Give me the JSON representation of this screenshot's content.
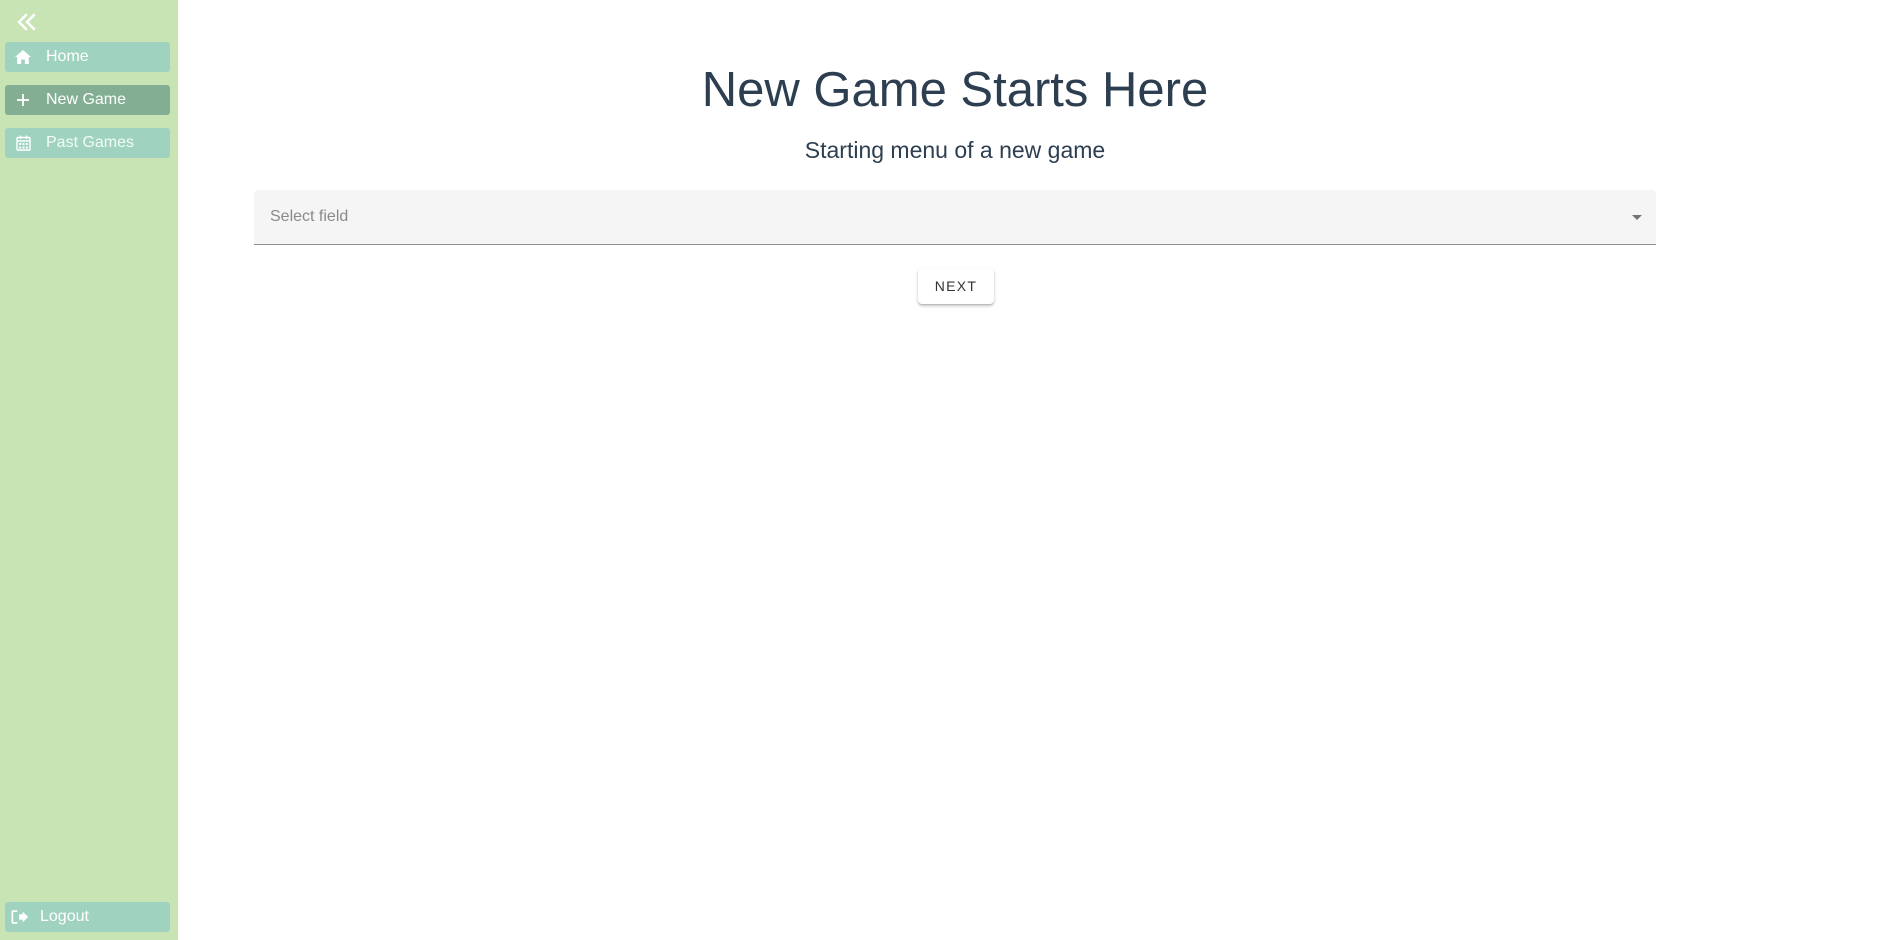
{
  "sidebar": {
    "collapse_icon": "double-chevron-left-icon",
    "items": [
      {
        "label": "Home",
        "icon": "home-icon",
        "active": false
      },
      {
        "label": "New Game",
        "icon": "plus-icon",
        "active": true
      },
      {
        "label": "Past Games",
        "icon": "calendar-icon",
        "active": false
      }
    ],
    "logout": {
      "label": "Logout",
      "icon": "logout-icon"
    },
    "colors": {
      "background": "#c9e4b4",
      "item": "#a0d2c0",
      "item_active": "#83ae94"
    }
  },
  "main": {
    "title": "New Game Starts Here",
    "subtitle": "Starting menu of a new game",
    "select": {
      "placeholder": "Select field",
      "value": ""
    },
    "next_label": "NEXT"
  }
}
